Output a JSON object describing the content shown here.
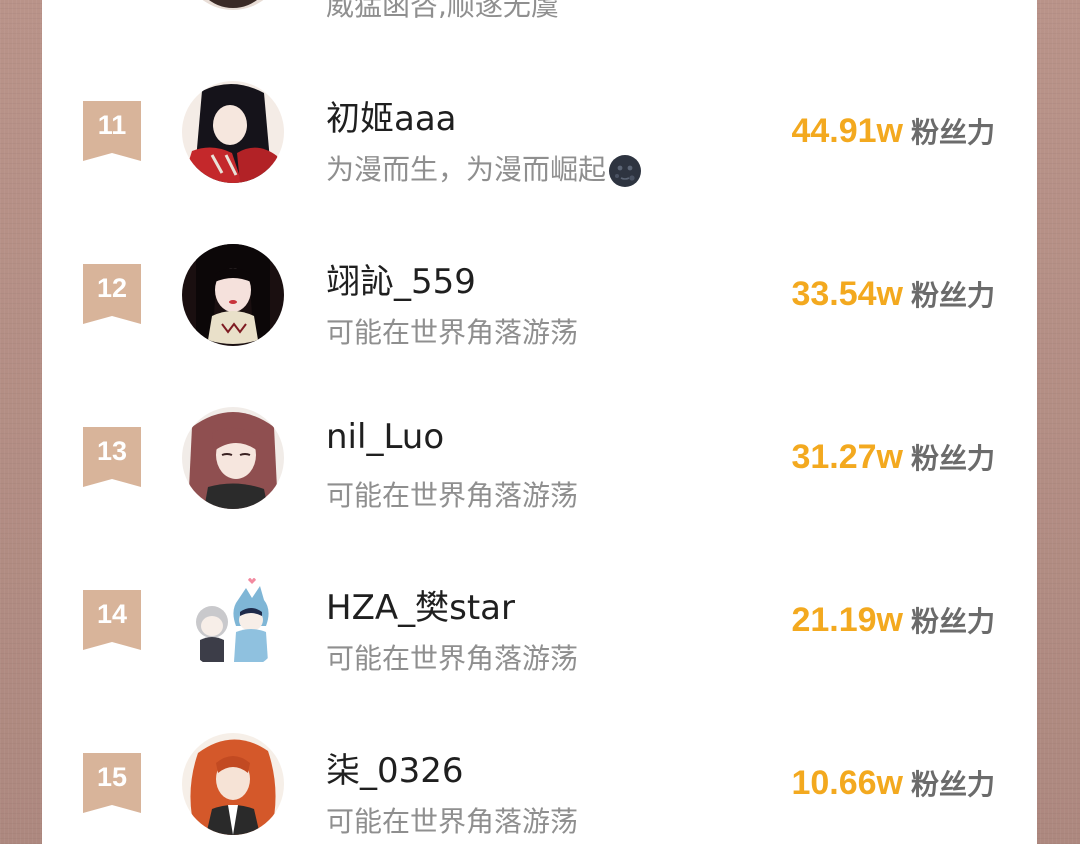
{
  "colors": {
    "accent": "#f3a91f",
    "badge": "#d8b49a",
    "name_text": "#1f1f1f",
    "bio_text": "#8f8f8f"
  },
  "partial_top": {
    "bio": "威猛函咨,顺遂无虞"
  },
  "rows": [
    {
      "rank": "11",
      "name": "初姬aaa",
      "bio": "为漫而生，为漫而崛起",
      "bio_emoji": "new-moon-face-icon",
      "value": "44.91w",
      "label": "粉丝力"
    },
    {
      "rank": "12",
      "name": "翊訫_559",
      "bio": "可能在世界角落游荡",
      "value": "33.54w",
      "label": "粉丝力"
    },
    {
      "rank": "13",
      "name": "nil_Luo",
      "bio": "可能在世界角落游荡",
      "value": "31.27w",
      "label": "粉丝力"
    },
    {
      "rank": "14",
      "name": "HZA_樊star",
      "bio": "可能在世界角落游荡",
      "value": "21.19w",
      "label": "粉丝力"
    },
    {
      "rank": "15",
      "name": "柒_0326",
      "bio": "可能在世界角落游荡",
      "value": "10.66w",
      "label": "粉丝力"
    }
  ]
}
